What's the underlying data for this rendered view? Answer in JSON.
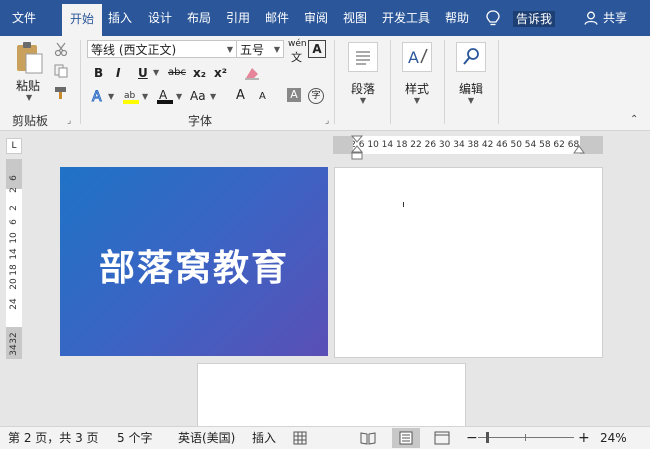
{
  "tabs": [
    "文件",
    "开始",
    "插入",
    "设计",
    "布局",
    "引用",
    "邮件",
    "审阅",
    "视图",
    "开发工具",
    "帮助"
  ],
  "tell_me": "告诉我",
  "share": "共享",
  "clipboard": {
    "paste": "粘贴",
    "group": "剪贴板"
  },
  "font": {
    "name": "等线 (西文正文)",
    "size": "五号",
    "wen": "wén",
    "group": "字体",
    "format_buttons": [
      "B",
      "I",
      "U",
      "abc",
      "x₂",
      "x²"
    ],
    "aa_label": "Aa",
    "grow_label": "A",
    "shrink_label": "A"
  },
  "paragraph": {
    "label": "段落"
  },
  "styles": {
    "label": "样式"
  },
  "editing": {
    "label": "编辑"
  },
  "h_ruler": "6  2     2    6  10 14 18 22 26 30 34 38 42 46 50 54 58 62    68 72",
  "v_ruler": [
    "6",
    "2",
    "2",
    "6",
    "10",
    "14",
    "18",
    "20",
    "24",
    "28",
    "32",
    "34"
  ],
  "slide_title": "部落窝教育",
  "status": {
    "page": "第 2 页，共 3 页",
    "words": "5 个字",
    "language": "英语(美国)",
    "mode": "插入",
    "zoom": "24%"
  },
  "colors": {
    "accent": "#2b579a",
    "slide_start": "#1f73c6",
    "slide_end": "#5a4fb6"
  }
}
